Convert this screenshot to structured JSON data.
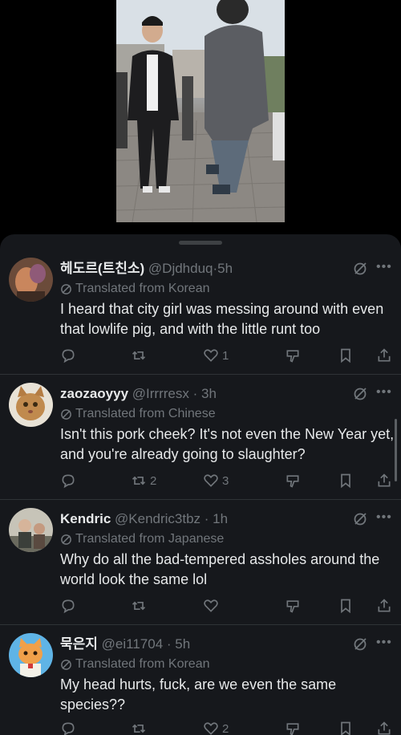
{
  "post_image": {
    "alt": "media"
  },
  "tweets": [
    {
      "name": "헤도르(트친소)",
      "handle": "@Djdhduq",
      "time": "5h",
      "translated": "Translated from Korean",
      "text": "I heard that city girl was messing around with even that lowlife pig, and with the little runt too",
      "replies": "",
      "retweets": "",
      "likes": "1"
    },
    {
      "name": "zaozaoyyy",
      "handle": "@Irrrresx",
      "time": "3h",
      "translated": "Translated from Chinese",
      "text": "Isn't this pork cheek? It's not even the New Year yet, and you're already going to slaughter?",
      "replies": "",
      "retweets": "2",
      "likes": "3"
    },
    {
      "name": "Kendric",
      "handle": "@Kendric3tbz",
      "time": "1h",
      "translated": "Translated from Japanese",
      "text": "Why do all the bad-tempered assholes around the world look the same lol",
      "replies": "",
      "retweets": "",
      "likes": ""
    },
    {
      "name": "묵은지",
      "handle": "@ei11704",
      "time": "5h",
      "translated": "Translated from Korean",
      "text": "My head hurts, fuck, are we even the same species??",
      "replies": "",
      "retweets": "",
      "likes": "2"
    }
  ],
  "colors": {
    "background": "#000000",
    "sheet": "#16181c",
    "muted": "#71767b",
    "text": "#e7e9ea",
    "divider": "#2f3336"
  }
}
